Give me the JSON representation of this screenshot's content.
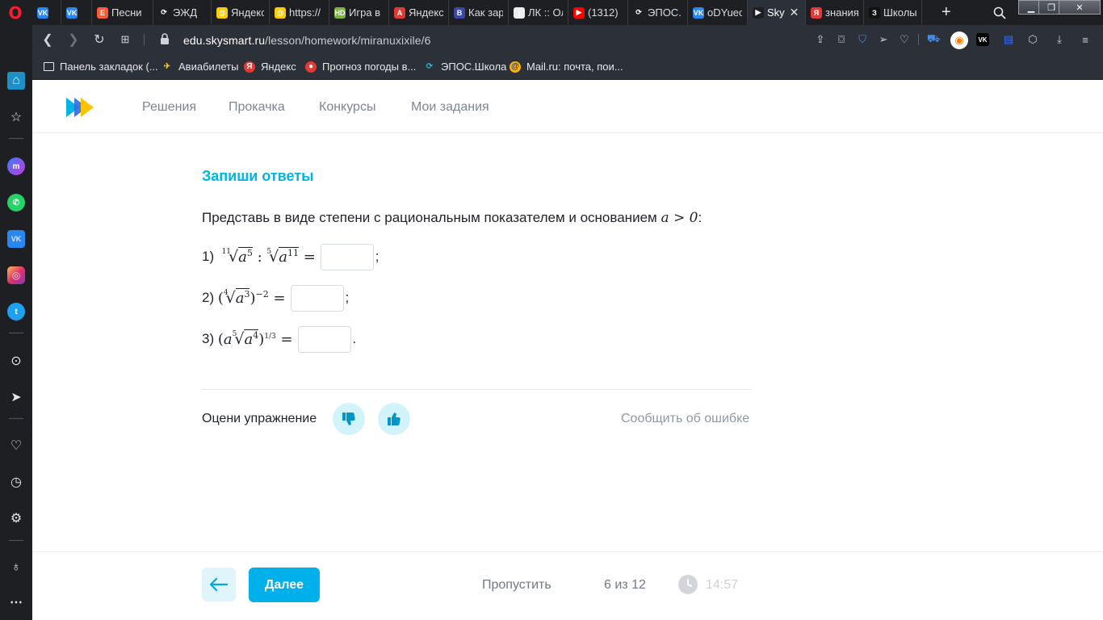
{
  "browser": {
    "tabs": [
      {
        "title": "",
        "fav_color": "#2787f5",
        "fav_text": "VK"
      },
      {
        "title": "",
        "fav_color": "#2787f5",
        "fav_text": "VK"
      },
      {
        "title": "Песни",
        "fav_color": "#ff5a36",
        "fav_text": "Е"
      },
      {
        "title": "ЭЖД",
        "fav_color": "#1e1f23",
        "fav_text": "⟳"
      },
      {
        "title": "Яндекс",
        "fav_color": "#ffcc00",
        "fav_text": "@"
      },
      {
        "title": "https://",
        "fav_color": "#ffcc00",
        "fav_text": "@"
      },
      {
        "title": "Игра в",
        "fav_color": "#7cb342",
        "fav_text": "HD"
      },
      {
        "title": "Яндекс",
        "fav_color": "#e53935",
        "fav_text": "A"
      },
      {
        "title": "Как зар",
        "fav_color": "#3949ab",
        "fav_text": "B"
      },
      {
        "title": "ЛК :: Ол",
        "fav_color": "#eeeeee",
        "fav_text": "|"
      },
      {
        "title": "(1312)",
        "fav_color": "#ff0000",
        "fav_text": "▶"
      },
      {
        "title": "ЭПОС.",
        "fav_color": "#1e1f23",
        "fav_text": "⟳"
      },
      {
        "title": "oDYuec",
        "fav_color": "#2787f5",
        "fav_text": "VK"
      },
      {
        "title": "Sky",
        "fav_color": "#1e1f23",
        "fav_text": "▶"
      },
      {
        "title": "знания",
        "fav_color": "#e53935",
        "fav_text": "Я"
      },
      {
        "title": "Школы",
        "fav_color": "#111111",
        "fav_text": "З"
      }
    ],
    "url_host": "edu.skysmart.ru",
    "url_path": "/lesson/homework/miranuxixile/6",
    "bookmarks": [
      {
        "label": "Панель закладок (...",
        "icon_color": "#2c3038",
        "icon_text": "▭"
      },
      {
        "label": "Авиабилеты",
        "icon_color": "#2c3038",
        "icon_text": "✈"
      },
      {
        "label": "Яндекс",
        "icon_color": "#e53935",
        "icon_text": "Я"
      },
      {
        "label": "Прогноз погоды в...",
        "icon_color": "#e53935",
        "icon_text": "●"
      },
      {
        "label": "ЭПОС.Школа",
        "icon_color": "#2c3038",
        "icon_text": "⟳"
      },
      {
        "label": "Mail.ru: почта, пои...",
        "icon_color": "#ffb300",
        "icon_text": "@"
      }
    ]
  },
  "site": {
    "nav": [
      "Решения",
      "Прокачка",
      "Конкурсы",
      "Мои задания"
    ],
    "task_heading": "Запиши ответы",
    "task_text": "Представь в виде степени с рациональным показателем и основанием",
    "task_condition": "a > 0",
    "task_colon": ":",
    "items": [
      {
        "num": "1)",
        "end": ";"
      },
      {
        "num": "2)",
        "end": ";"
      },
      {
        "num": "3)",
        "end": "."
      }
    ],
    "rate_label": "Оцени упражнение",
    "report": "Сообщить об ошибке",
    "next": "Далее",
    "skip": "Пропустить",
    "progress": "6 из 12",
    "timer": "14:57"
  }
}
